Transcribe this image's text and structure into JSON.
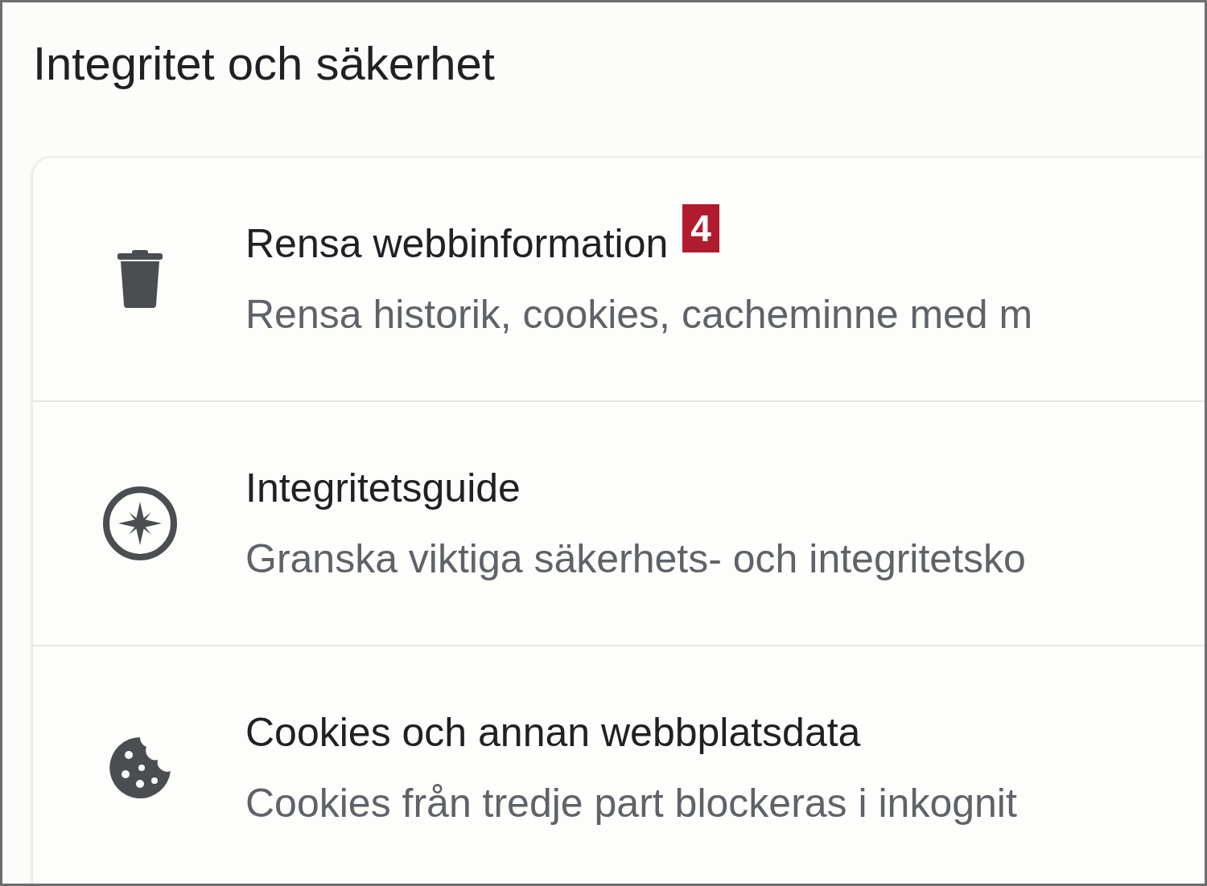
{
  "page_title": "Integritet och säkerhet",
  "rows": [
    {
      "kind": "trash",
      "title": "Rensa webbinformation",
      "badge": "4",
      "subtitle": "Rensa historik, cookies, cacheminne med m"
    },
    {
      "kind": "compass",
      "title": "Integritetsguide",
      "subtitle": "Granska viktiga säkerhets- och integritetsko"
    },
    {
      "kind": "cookie",
      "title": "Cookies och annan webbplatsdata",
      "subtitle": "Cookies från tredje part blockeras i inkognit"
    }
  ]
}
